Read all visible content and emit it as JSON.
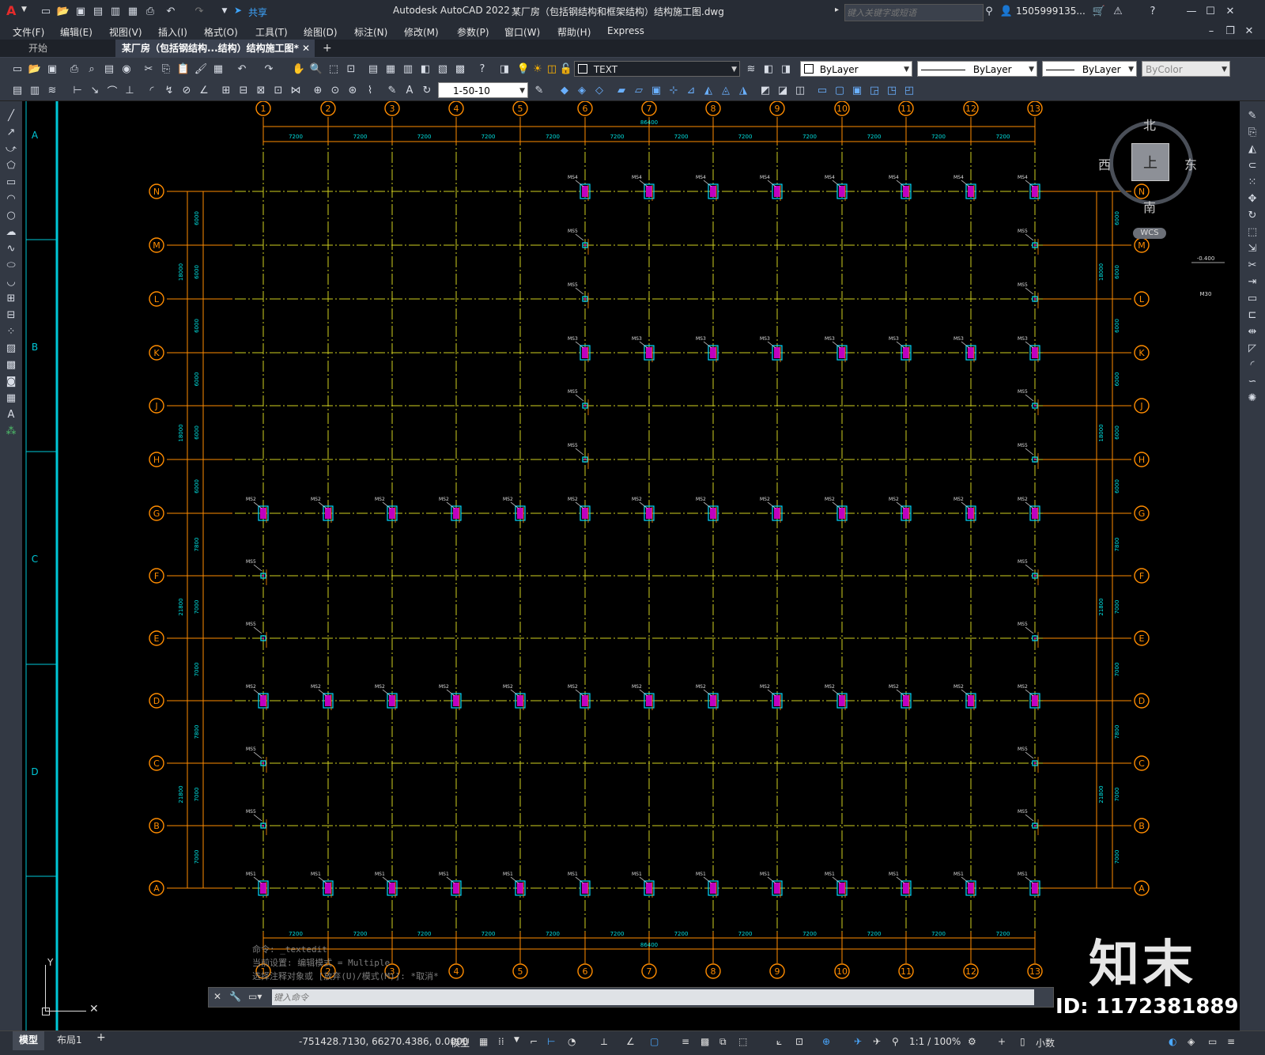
{
  "app": {
    "title": "Autodesk AutoCAD 2022",
    "doc_title": "某厂房（包括钢结构和框架结构）结构施工图.dwg",
    "share_label": "共享",
    "search_placeholder": "键入关键字或短语",
    "user": "1505999135...",
    "logo_letter": "A"
  },
  "menu": [
    "文件(F)",
    "编辑(E)",
    "视图(V)",
    "插入(I)",
    "格式(O)",
    "工具(T)",
    "绘图(D)",
    "标注(N)",
    "修改(M)",
    "参数(P)",
    "窗口(W)",
    "帮助(H)",
    "Express"
  ],
  "tabs": {
    "start": "开始",
    "active": "某厂房（包括钢结构...结构）结构施工图*",
    "add": "+"
  },
  "toolbar": {
    "text_style": "TEXT",
    "layer_color": "ByLayer",
    "linetype": "ByLayer",
    "lineweight": "ByLayer",
    "plotstyle": "ByColor",
    "dim_style": "1-50-10"
  },
  "viewcube": {
    "n": "北",
    "s": "南",
    "e": "东",
    "w": "西",
    "top": "上",
    "wcs": "WCS"
  },
  "grid": {
    "col_labels": [
      "1",
      "2",
      "3",
      "4",
      "5",
      "6",
      "7",
      "8",
      "9",
      "10",
      "11",
      "12",
      "13"
    ],
    "row_labels": [
      "N",
      "M",
      "L",
      "K",
      "J",
      "H",
      "G",
      "F",
      "E",
      "D",
      "C",
      "B",
      "A"
    ],
    "span_label": "7200",
    "total_label": "86400",
    "row_dims": [
      "6000",
      "6000",
      "6000",
      "6000",
      "6000",
      "6000",
      "7800",
      "7000",
      "7000",
      "7800",
      "7000",
      "7000"
    ],
    "group_dims_left": [
      "18000",
      "18000",
      "21800",
      "21800"
    ],
    "group_dims_right": [
      "18000",
      "18000",
      "21800",
      "21800"
    ],
    "zones": [
      "A",
      "B",
      "C",
      "D"
    ]
  },
  "elevation": {
    "value": "-0.400",
    "mark": "M30"
  },
  "command": {
    "history": [
      "命令:  _textedit",
      "当前设置: 编辑模式 = Multiple",
      "选择注释对象或 [放弃(U)/模式(M)]: *取消*"
    ],
    "placeholder": "键入命令"
  },
  "status": {
    "model_tab": "模型",
    "layout_tab": "布局1",
    "coords": "-751428.7130, 66270.4386, 0.0000",
    "model_btn": "模型",
    "scale": "1:1 / 100%",
    "units": "小数"
  },
  "watermark": {
    "brand": "知末",
    "id": "ID: 1172381889"
  },
  "colors": {
    "grid_line": "#d0d020",
    "axis": "#ff8c00",
    "dim": "#ff8c00",
    "text": "#00e0e0",
    "bubble": "#ff8c00"
  }
}
